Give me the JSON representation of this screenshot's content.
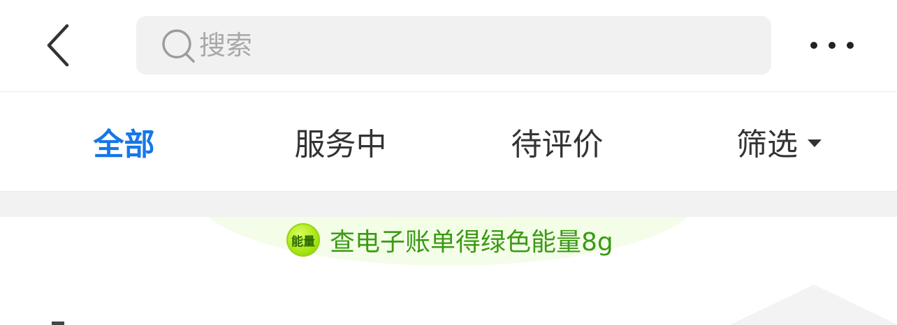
{
  "header": {
    "search": {
      "placeholder": "搜索",
      "value": ""
    }
  },
  "tabs": [
    {
      "label": "全部",
      "active": true
    },
    {
      "label": "服务中",
      "active": false
    },
    {
      "label": "待评价",
      "active": false
    },
    {
      "label": "筛选",
      "active": false
    }
  ],
  "banner": {
    "badge": "能量",
    "text": "查电子账单得绿色能量8g"
  },
  "colors": {
    "accent": "#1677e8",
    "energy_text": "#3a9a14",
    "background": "#ffffff",
    "strip": "#f2f2f2"
  },
  "icons": [
    "back-arrow-icon",
    "search-icon",
    "more-icon",
    "caret-down-icon",
    "energy-icon"
  ]
}
